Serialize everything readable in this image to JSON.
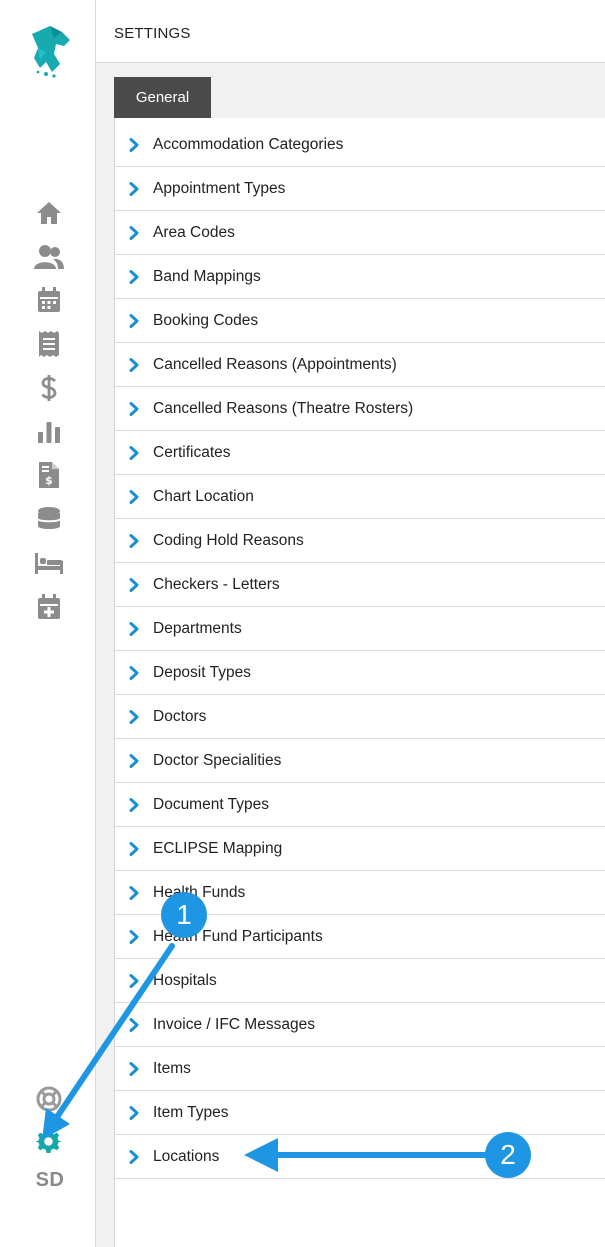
{
  "header": {
    "title": "SETTINGS"
  },
  "tabs": [
    {
      "label": "General",
      "active": true
    }
  ],
  "settings_list": [
    {
      "label": "Accommodation Categories"
    },
    {
      "label": "Appointment Types"
    },
    {
      "label": "Area Codes"
    },
    {
      "label": "Band Mappings"
    },
    {
      "label": "Booking Codes"
    },
    {
      "label": "Cancelled Reasons (Appointments)"
    },
    {
      "label": "Cancelled Reasons (Theatre Rosters)"
    },
    {
      "label": "Certificates"
    },
    {
      "label": "Chart Location"
    },
    {
      "label": "Coding Hold Reasons"
    },
    {
      "label": "Checkers - Letters"
    },
    {
      "label": "Departments"
    },
    {
      "label": "Deposit Types"
    },
    {
      "label": "Doctors"
    },
    {
      "label": "Doctor Specialities"
    },
    {
      "label": "Document Types"
    },
    {
      "label": "ECLIPSE Mapping"
    },
    {
      "label": "Health Funds"
    },
    {
      "label": "Health Fund Participants"
    },
    {
      "label": "Hospitals"
    },
    {
      "label": "Invoice / IFC Messages"
    },
    {
      "label": "Items"
    },
    {
      "label": "Item Types"
    },
    {
      "label": "Locations"
    }
  ],
  "sidebar": {
    "icons": [
      "home-icon",
      "users-icon",
      "calendar-icon",
      "receipt-icon",
      "dollar-icon",
      "bar-chart-icon",
      "invoice-icon",
      "database-icon",
      "bed-icon",
      "calendar-plus-icon",
      "support-icon",
      "gear-icon"
    ],
    "user_initials": "SD"
  },
  "annotations": [
    {
      "number": "1"
    },
    {
      "number": "2"
    }
  ],
  "colors": {
    "accent": "#1e96e3",
    "chevron": "#1b8ed6",
    "active_icon": "#16a8a8",
    "nav_icon": "#8c8c8c",
    "tab_bg": "#4a4a4a"
  }
}
